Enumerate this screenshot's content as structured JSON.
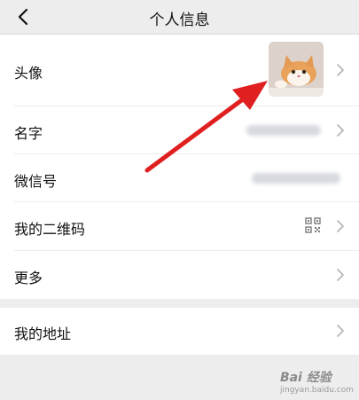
{
  "header": {
    "title": "个人信息",
    "back_icon": "chevron-left-icon"
  },
  "profile": {
    "rows": [
      {
        "label": "头像"
      },
      {
        "label": "名字"
      },
      {
        "label": "微信号"
      },
      {
        "label": "我的二维码"
      },
      {
        "label": "更多"
      }
    ],
    "avatar_image": "cat-avatar",
    "qr_icon": "qr-code-icon"
  },
  "section2": {
    "rows": [
      {
        "label": "我的地址"
      }
    ]
  },
  "annotation": {
    "arrow_color": "#e02020"
  },
  "watermark": {
    "text": "Bai 经验",
    "subtext": "jingyan.baidu.com"
  }
}
